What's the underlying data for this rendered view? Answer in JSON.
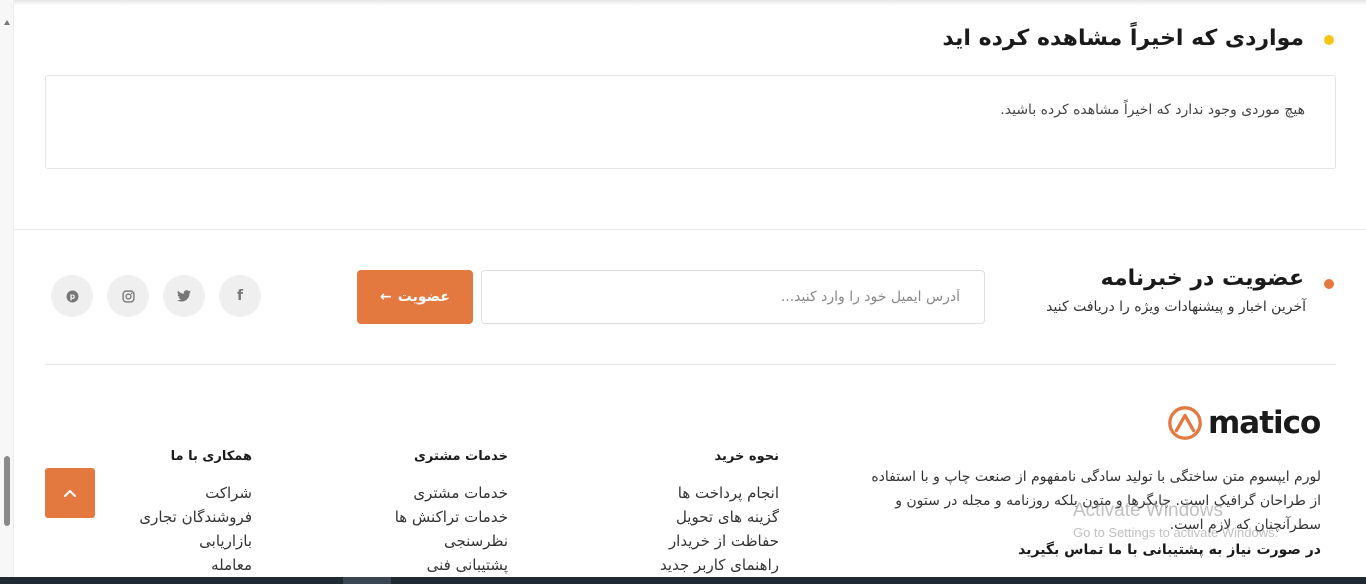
{
  "recently_viewed": {
    "title": "مواردی که اخیراً مشاهده کرده اید",
    "empty_message": "هیچ موردی وجود ندارد که اخیراً مشاهده کرده باشید."
  },
  "newsletter": {
    "title": "عضویت در خبرنامه",
    "subtitle": "آخرین اخبار و پیشنهادات ویژه را دریافت کنید",
    "email_placeholder": "آدرس ایمیل خود را وارد کنید...",
    "email_value": "",
    "subscribe_label": "عضویت",
    "subscribe_arrow": "←"
  },
  "social": [
    {
      "name": "facebook-icon",
      "glyph": "f"
    },
    {
      "name": "twitter-icon",
      "glyph": "t"
    },
    {
      "name": "instagram-icon",
      "glyph": "◎"
    },
    {
      "name": "pinterest-icon",
      "glyph": "p"
    }
  ],
  "footer": {
    "logo_text": "matico",
    "about": "لورم ایپسوم متن ساختگی با تولید سادگی نامفهوم از صنعت چاپ و با استفاده از طراحان گرافیک است. چاپگرها و متون بلکه روزنامه و مجله در ستون و سطرآنچنان که لازم است.",
    "support_text": "در صورت نیاز به پشتیبانی با ما تماس بگیرید",
    "columns": [
      {
        "title": "نحوه خرید",
        "links": [
          "انجام پرداخت ها",
          "گزینه های تحویل",
          "حفاظت از خریدار",
          "راهنمای کاربر جدید"
        ]
      },
      {
        "title": "خدمات مشتری",
        "links": [
          "خدمات مشتری",
          "خدمات تراکنش ها",
          "نظرسنجی",
          "پشتیبانی فنی"
        ]
      },
      {
        "title": "همکاری با ما",
        "links": [
          "شراکت",
          "فروشندگان تجاری",
          "بازاریابی",
          "معامله"
        ]
      }
    ]
  },
  "watermark": {
    "line1": "Activate Windows",
    "line2": "Go to Settings to activate Windows."
  },
  "colors": {
    "accent": "#e4793f",
    "yellow_dot": "#f5c518"
  }
}
